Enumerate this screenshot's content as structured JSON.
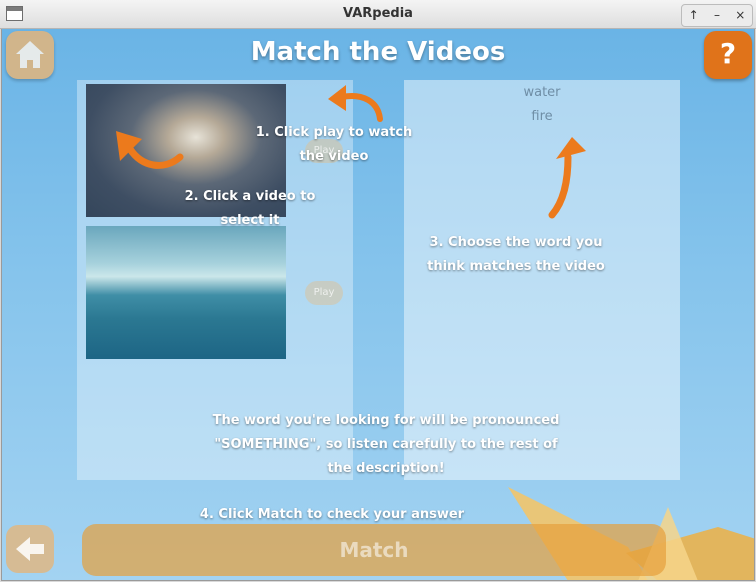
{
  "window": {
    "title": "VARpedia"
  },
  "window_buttons": [
    "↑",
    "–",
    "×"
  ],
  "page": {
    "heading": "Match the Videos"
  },
  "help_button": {
    "label": "?"
  },
  "videos": [
    {
      "play_label": "Play"
    },
    {
      "play_label": "Play"
    }
  ],
  "words": [
    "water",
    "fire"
  ],
  "hints": {
    "step1": "1. Click play to watch the video",
    "step2": "2. Click a video to select it",
    "step3": "3. Choose the word you think matches the video",
    "pronounce": "The word you're looking for will be pronounced \"SOMETHING\", so listen carefully to the rest of the description!",
    "step4": "4. Click Match to check your answer"
  },
  "match_button": {
    "label": "Match"
  },
  "colors": {
    "accent_orange": "#e0731a",
    "sky_top": "#6ab4e6",
    "sky_bottom": "#a3d3f2"
  },
  "icons": [
    "home-icon",
    "help-icon",
    "back-arrow-icon"
  ]
}
